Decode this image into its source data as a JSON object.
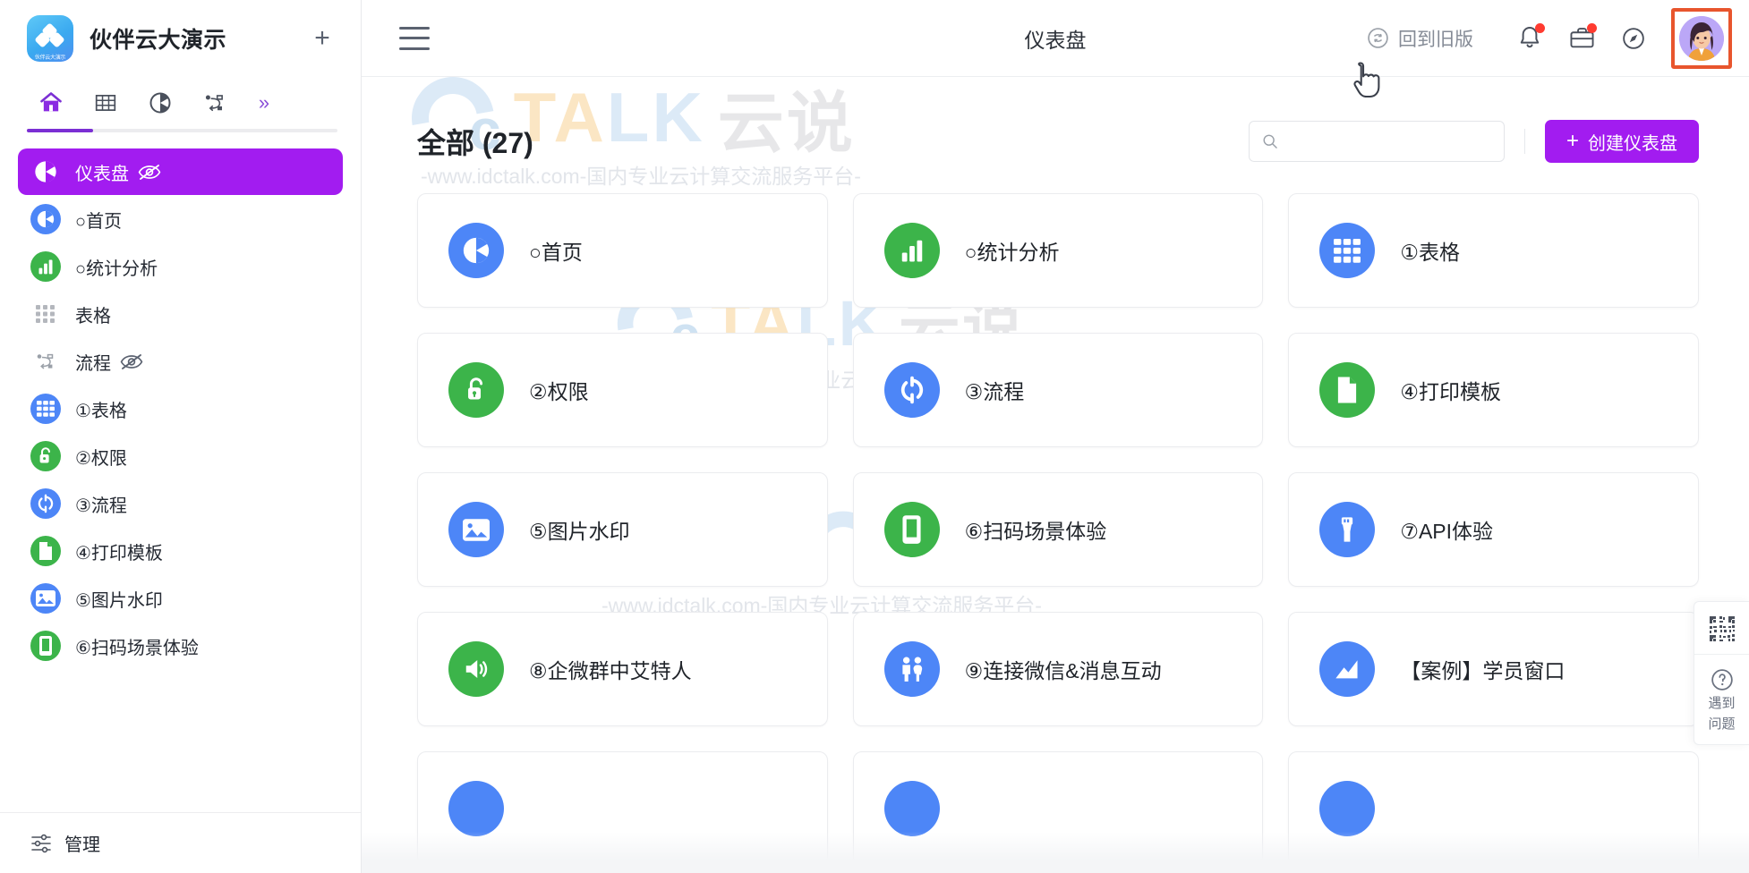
{
  "sidebar": {
    "workspace_name": "伙伴云大演示",
    "logo_label": "伙伴云大演示",
    "add_button": "+",
    "tabs": [
      {
        "name": "home-tab",
        "icon": "home-icon",
        "active": true
      },
      {
        "name": "table-tab",
        "icon": "table-grid-icon",
        "active": false
      },
      {
        "name": "dashboard-tab",
        "icon": "pie-chart-icon",
        "active": false
      },
      {
        "name": "flow-tab",
        "icon": "flow-nodes-icon",
        "active": false
      },
      {
        "name": "more-tab",
        "icon": "chevron-double-right-icon",
        "active": false,
        "label": "»"
      }
    ],
    "items": [
      {
        "label": "仪表盘",
        "icon": "pie-chart-icon",
        "color": "#ffffff",
        "bg": "transparent",
        "active": true,
        "hidden_eye": true
      },
      {
        "label": "○首页",
        "icon": "pie-chart-icon",
        "color": "#ffffff",
        "bg": "#4d86f7",
        "active": false,
        "hidden_eye": false
      },
      {
        "label": "○统计分析",
        "icon": "bar-chart-icon",
        "color": "#ffffff",
        "bg": "#3cb44a",
        "active": false,
        "hidden_eye": false
      },
      {
        "label": "表格",
        "icon": "grid-dots-icon",
        "color": "#b4b7bd",
        "bg": "transparent",
        "active": false,
        "hidden_eye": false
      },
      {
        "label": "流程",
        "icon": "flow-nodes-icon",
        "color": "#9aa0a8",
        "bg": "transparent",
        "active": false,
        "hidden_eye": true
      },
      {
        "label": "①表格",
        "icon": "table-grid-icon",
        "color": "#ffffff",
        "bg": "#4d86f7",
        "active": false,
        "hidden_eye": false
      },
      {
        "label": "②权限",
        "icon": "lock-open-icon",
        "color": "#ffffff",
        "bg": "#3cb44a",
        "active": false,
        "hidden_eye": false
      },
      {
        "label": "③流程",
        "icon": "refresh-cycle-icon",
        "color": "#ffffff",
        "bg": "#4d86f7",
        "active": false,
        "hidden_eye": false
      },
      {
        "label": "④打印模板",
        "icon": "document-icon",
        "color": "#ffffff",
        "bg": "#3cb44a",
        "active": false,
        "hidden_eye": false
      },
      {
        "label": "⑤图片水印",
        "icon": "image-icon",
        "color": "#ffffff",
        "bg": "#4d86f7",
        "active": false,
        "hidden_eye": false
      },
      {
        "label": "⑥扫码场景体验",
        "icon": "mobile-phone-icon",
        "color": "#ffffff",
        "bg": "#3cb44a",
        "active": false,
        "hidden_eye": false
      }
    ],
    "footer": {
      "label": "管理",
      "icon": "settings-sliders-icon"
    }
  },
  "topbar": {
    "menu_icon": "hamburger-menu-icon",
    "title": "仪表盘",
    "legacy_button": "回到旧版",
    "legacy_icon": "switch-version-icon",
    "notification_icon": "bell-icon",
    "notification_has_badge": true,
    "briefcase_icon": "briefcase-icon",
    "briefcase_has_badge": true,
    "compass_icon": "compass-icon",
    "avatar_name": "user-avatar",
    "avatar_highlight_color": "#e8552d"
  },
  "content": {
    "page_title": "全部 (27)",
    "search": {
      "placeholder": "",
      "value": "",
      "icon": "search-icon"
    },
    "create_button": {
      "label": "创建仪表盘",
      "plus": "+",
      "color": "#a21cf0"
    },
    "cards": [
      {
        "label": "○首页",
        "icon": "pie-chart-icon",
        "bg": "#4d86f7"
      },
      {
        "label": "○统计分析",
        "icon": "bar-chart-icon",
        "bg": "#3cb44a"
      },
      {
        "label": "①表格",
        "icon": "table-grid-icon",
        "bg": "#4d86f7"
      },
      {
        "label": "②权限",
        "icon": "lock-open-icon",
        "bg": "#3cb44a"
      },
      {
        "label": "③流程",
        "icon": "refresh-cycle-icon",
        "bg": "#4d86f7"
      },
      {
        "label": "④打印模板",
        "icon": "document-icon",
        "bg": "#3cb44a"
      },
      {
        "label": "⑤图片水印",
        "icon": "image-icon",
        "bg": "#4d86f7"
      },
      {
        "label": "⑥扫码场景体验",
        "icon": "mobile-phone-icon",
        "bg": "#3cb44a"
      },
      {
        "label": "⑦API体验",
        "icon": "plug-icon",
        "bg": "#4d86f7"
      },
      {
        "label": "⑧企微群中艾特人",
        "icon": "speaker-icon",
        "bg": "#3cb44a"
      },
      {
        "label": "⑨连接微信&消息互动",
        "icon": "people-icon",
        "bg": "#4d86f7"
      },
      {
        "label": "【案例】学员窗口",
        "icon": "line-chart-icon",
        "bg": "#4d86f7"
      },
      {
        "label": "",
        "icon": "partial-icon",
        "bg": "#4d86f7"
      },
      {
        "label": "",
        "icon": "partial-icon",
        "bg": "#4d86f7"
      },
      {
        "label": "",
        "icon": "partial-icon",
        "bg": "#4d86f7"
      }
    ]
  },
  "float_widget": {
    "qr_icon": "qr-code-icon",
    "help_icon": "question-circle-icon",
    "help_label_line1": "遇到",
    "help_label_line2": "问题"
  },
  "watermark": {
    "brand_t": "T",
    "brand_a": "A",
    "brand_l": "L",
    "brand_k": "K",
    "brand_cn": "云说",
    "url": "-www.idctalk.com-国内专业云计算交流服务平台-"
  }
}
